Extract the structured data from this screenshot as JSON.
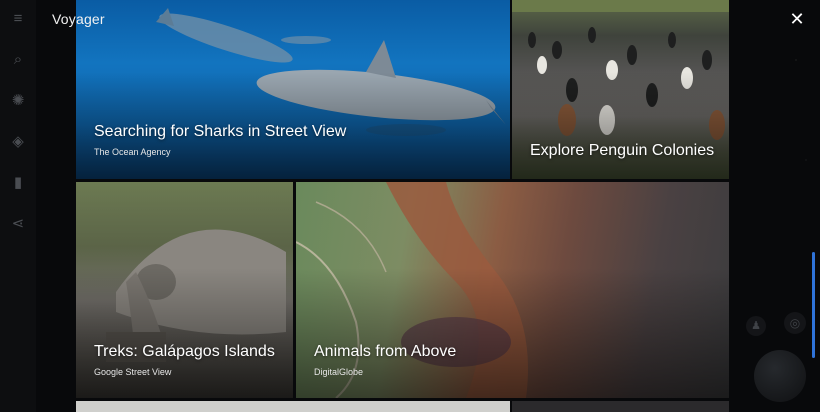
{
  "window": {
    "title": "Voyager",
    "close_label": "✕"
  },
  "sidebar": {
    "items": [
      {
        "name": "menu-icon",
        "glyph": "≡"
      },
      {
        "name": "search-icon",
        "glyph": "⌕"
      },
      {
        "name": "voyager-icon",
        "glyph": "✺"
      },
      {
        "name": "random-icon",
        "glyph": "◈"
      },
      {
        "name": "bookmark-icon",
        "glyph": "▮"
      },
      {
        "name": "share-icon",
        "glyph": "⋖"
      }
    ]
  },
  "cards": [
    {
      "title": "Searching for Sharks in Street View",
      "subtitle": "The Ocean Agency"
    },
    {
      "title": "Explore Penguin Colonies",
      "subtitle": ""
    },
    {
      "title": "Treks: Galápagos Islands",
      "subtitle": "Google Street View"
    },
    {
      "title": "Animals from Above",
      "subtitle": "DigitalGlobe"
    }
  ],
  "colors": {
    "scrollbar": "#2f73d9",
    "background": "#050608"
  }
}
